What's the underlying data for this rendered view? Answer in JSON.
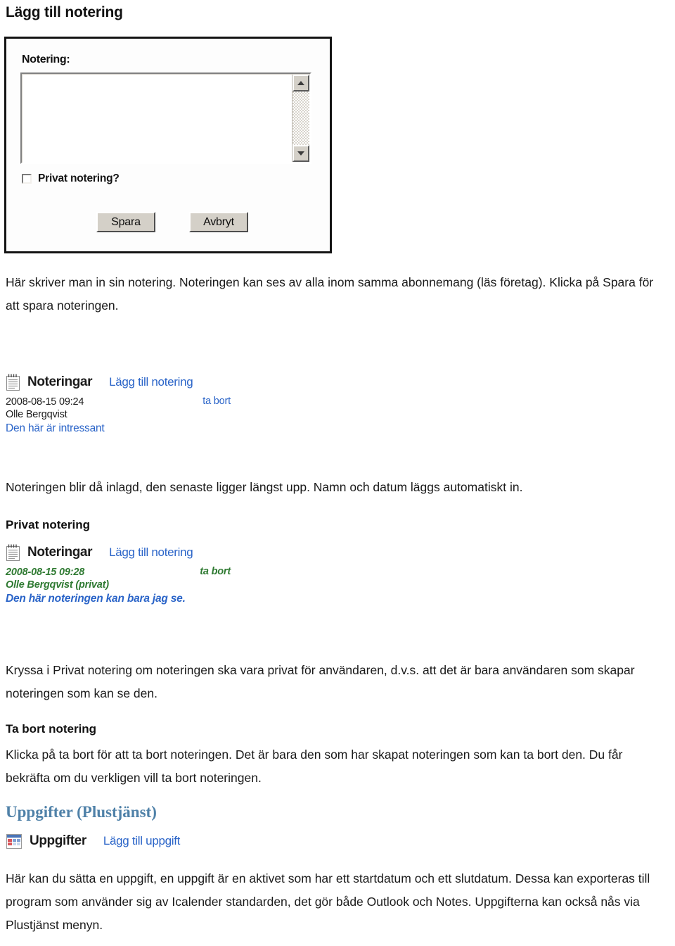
{
  "page": {
    "title": "Lägg till notering"
  },
  "dialog": {
    "field_label": "Notering:",
    "textarea_value": "",
    "textarea_placeholder": "",
    "checkbox_label": "Privat notering?",
    "checkbox_checked": false,
    "save_label": "Spara",
    "cancel_label": "Avbryt",
    "scroll_up_icon": "triangle-up-icon",
    "scroll_down_icon": "triangle-down-icon"
  },
  "paragraph_1": "Här skriver man in sin notering. Noteringen kan ses av alla inom samma abonnemang (läs företag). Klicka på Spara för att spara noteringen.",
  "notes_widget_public": {
    "icon": "notepad-icon",
    "title": "Noteringar",
    "add_link": "Lägg till notering",
    "notes": [
      {
        "timestamp": "2008-08-15 09:24",
        "author": "Olle Bergqvist",
        "text": "Den här är intressant",
        "delete_link": "ta bort"
      }
    ]
  },
  "paragraph_2": "Noteringen blir då inlagd, den senaste ligger längst upp. Namn och datum läggs automatiskt in.",
  "heading_private": "Privat notering",
  "notes_widget_private": {
    "icon": "notepad-icon",
    "title": "Noteringar",
    "add_link": "Lägg till notering",
    "notes": [
      {
        "timestamp": "2008-08-15 09:28",
        "author": "Olle Bergqvist (privat)",
        "text": "Den här noteringen kan bara jag se.",
        "delete_link": "ta bort"
      }
    ]
  },
  "paragraph_3": "Kryssa i Privat notering om noteringen ska vara privat för användaren, d.v.s. att det är bara användaren som skapar noteringen som kan se den.",
  "heading_delete": "Ta bort notering",
  "paragraph_4": "Klicka på ta bort för att ta bort noteringen. Det är bara den som har skapat noteringen som kan ta bort den. Du får bekräfta om du verkligen vill ta bort noteringen.",
  "heading_uppgifter": "Uppgifter (Plustjänst)",
  "tasks_widget": {
    "icon": "calendar-table-icon",
    "title": "Uppgifter",
    "add_link": "Lägg till uppgift"
  },
  "paragraph_5": "Här kan du sätta en uppgift, en uppgift är en aktivet som har ett startdatum och ett slutdatum. Dessa kan exporteras till program som använder sig av Icalender standarden, det gör både Outlook och Notes. Uppgifterna kan också nås via Plustjänst menyn.",
  "colors": {
    "link_blue": "#2a64c8",
    "private_green": "#2f7a32",
    "heading_blue": "#4f81a8",
    "dialog_face": "#d4d0c8"
  }
}
